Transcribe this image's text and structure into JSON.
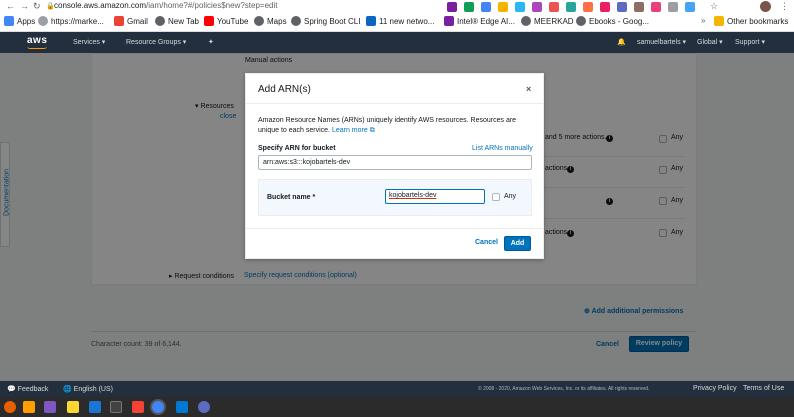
{
  "browser": {
    "url_host": "console.aws.amazon.com",
    "url_path": "/iam/home?#/policies$new?step=edit",
    "bookmarks": [
      {
        "label": "Apps",
        "color": "#4285f4"
      },
      {
        "label": "https://marke...",
        "color": "#5f6368"
      },
      {
        "label": "Gmail",
        "color": "#ea4335"
      },
      {
        "label": "New Tab",
        "color": "#202124"
      },
      {
        "label": "YouTube",
        "color": "#ff0000"
      },
      {
        "label": "Maps",
        "color": "#202124"
      },
      {
        "label": "Spring Boot CLI",
        "color": "#202124"
      },
      {
        "label": "11 new netwo...",
        "color": "#0a66c2"
      },
      {
        "label": "Intel® Edge AI...",
        "color": "#7b1fa2"
      },
      {
        "label": "MEERKAD",
        "color": "#202124"
      },
      {
        "label": "Ebooks - Goog...",
        "color": "#202124"
      },
      {
        "label": "Other bookmarks",
        "color": "#f4b400"
      }
    ]
  },
  "aws_nav": {
    "logo": "aws",
    "services": "Services",
    "resource_groups": "Resource Groups",
    "user": "samuelbartels",
    "region": "Global",
    "support": "Support"
  },
  "sidebar": {
    "documentation": "Documentation"
  },
  "policy_editor": {
    "manual_actions": "Manual actions",
    "resources_label": "Resources",
    "close_link": "close",
    "more_actions": "and 5 more actions.",
    "actions_text": "actions.",
    "any_label": "Any",
    "request_conditions_label": "Request conditions",
    "request_conditions_link": "Specify request conditions (optional)",
    "add_permissions": "Add additional permissions",
    "char_count": "Character count: 39 of 6,144.",
    "cancel": "Cancel",
    "review_policy": "Review policy"
  },
  "modal": {
    "title": "Add ARN(s)",
    "close_icon": "×",
    "description": "Amazon Resource Names (ARNs) uniquely identify AWS resources. Resources are unique to each service.",
    "learn_more": "Learn more",
    "specify_label": "Specify ARN for bucket",
    "list_arns": "List ARNs manually",
    "arn_value": "arn:aws:s3:::kojobartels-dev",
    "bucket_name_label": "Bucket name *",
    "bucket_name_value": "kojobartels-dev",
    "any_label": "Any",
    "cancel": "Cancel",
    "add": "Add"
  },
  "footer": {
    "feedback": "Feedback",
    "language": "English (US)",
    "copyright": "© 2008 - 2020, Amazon Web Services, Inc. or its affiliates. All rights reserved.",
    "privacy": "Privacy Policy",
    "terms": "Terms of Use"
  }
}
